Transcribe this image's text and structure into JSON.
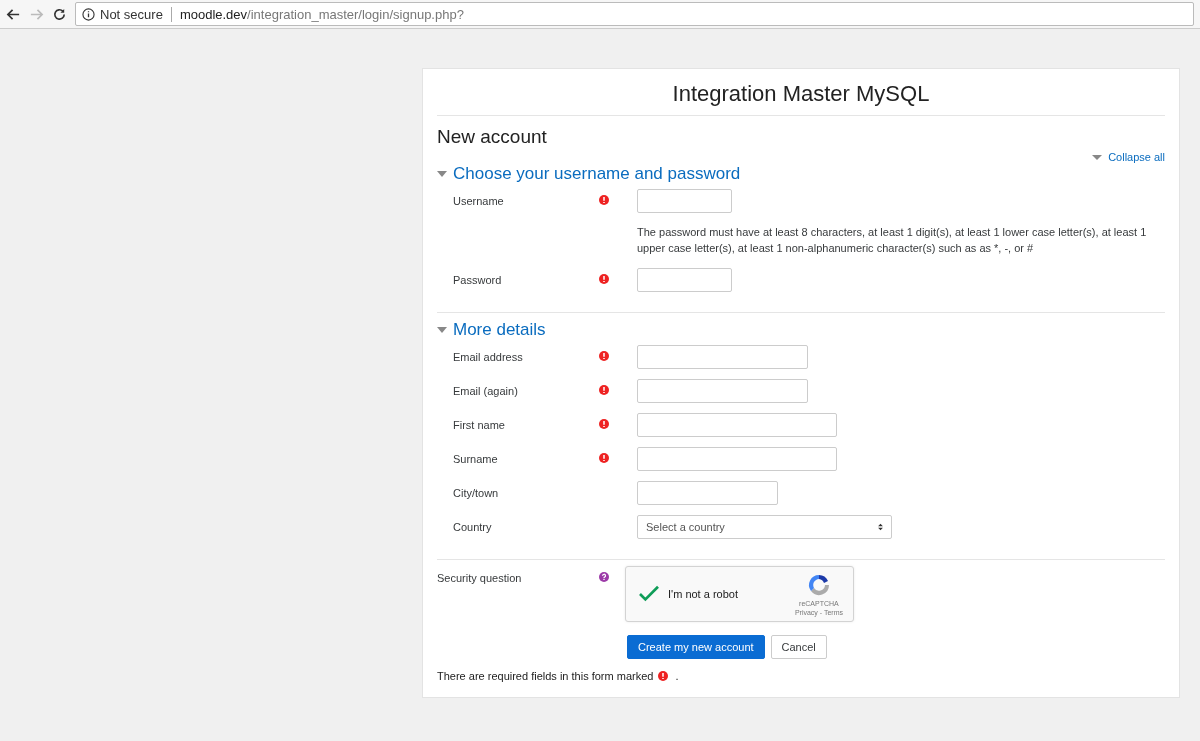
{
  "browser": {
    "security": "Not secure",
    "url_host": "moodle.dev",
    "url_path": "/integration_master/login/signup.php?"
  },
  "site_title": "Integration Master MySQL",
  "heading": "New account",
  "collapse_all": "Collapse all",
  "sections": [
    {
      "title": "Choose your username and password",
      "expanded": true,
      "fields": [
        {
          "label": "Username",
          "required": true,
          "kind": "text"
        },
        {
          "label": "Password",
          "required": true,
          "kind": "text",
          "note": "The password must have at least 8 characters, at least 1 digit(s), at least 1 lower case letter(s), at least 1 upper case letter(s), at least 1 non-alphanumeric character(s) such as as *, -, or #"
        }
      ]
    },
    {
      "title": "More details",
      "expanded": true,
      "fields": [
        {
          "label": "Email address",
          "required": true,
          "kind": "text"
        },
        {
          "label": "Email (again)",
          "required": true,
          "kind": "text"
        },
        {
          "label": "First name",
          "required": true,
          "kind": "text"
        },
        {
          "label": "Surname",
          "required": true,
          "kind": "text"
        },
        {
          "label": "City/town",
          "required": false,
          "kind": "text"
        },
        {
          "label": "Country",
          "required": false,
          "kind": "select",
          "value": "Select a country"
        }
      ]
    }
  ],
  "security": {
    "label": "Security question",
    "captcha_label": "I'm not a robot",
    "checked": true,
    "brand": "reCAPTCHA",
    "links": "Privacy - Terms"
  },
  "buttons": [
    "Create my new account",
    "Cancel"
  ],
  "footer_text": "There are required fields in this form marked",
  "footer_end": "."
}
